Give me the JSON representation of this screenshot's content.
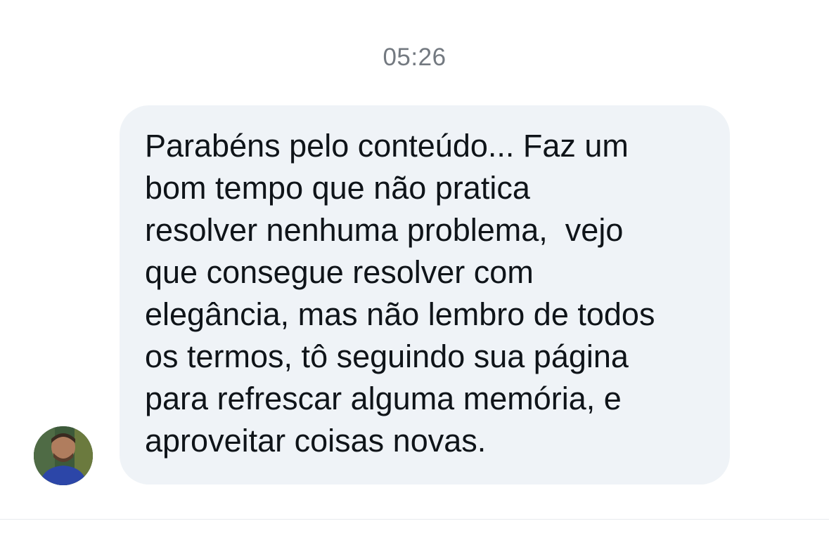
{
  "conversation": {
    "timestamp": "05:26",
    "message": {
      "text": "Parabéns pelo conteúdo... Faz um\nbom tempo que não pratica\nresolver nenhuma problema,  vejo\nque consegue resolver com\nelegância, mas não lembro de todos\nos termos, tô seguindo sua página\npara refrescar alguma memória, e\naproveitar coisas novas.",
      "bubble_color": "#eff3f7",
      "text_color": "#0f1419"
    },
    "timestamp_color": "#737980"
  }
}
